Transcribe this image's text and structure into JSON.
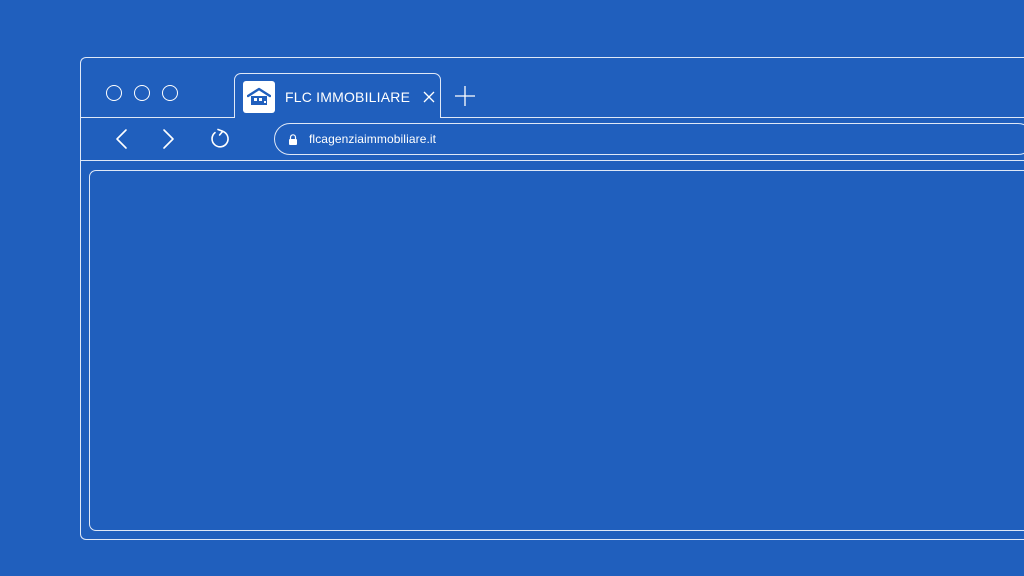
{
  "window": {
    "controls": [
      "close",
      "minimize",
      "maximize"
    ]
  },
  "tab": {
    "title": "FLC IMMOBILIARE",
    "favicon": "house-logo-icon",
    "close_icon": "close-icon"
  },
  "toolbar": {
    "back_icon": "chevron-left-icon",
    "forward_icon": "chevron-right-icon",
    "reload_icon": "reload-icon",
    "new_tab_icon": "plus-icon"
  },
  "address_bar": {
    "url": "flcagenziaimmobiliare.it",
    "lock_icon": "lock-icon"
  },
  "colors": {
    "background": "#205fbd",
    "outline": "#dfe8f7",
    "foreground": "#ffffff"
  }
}
